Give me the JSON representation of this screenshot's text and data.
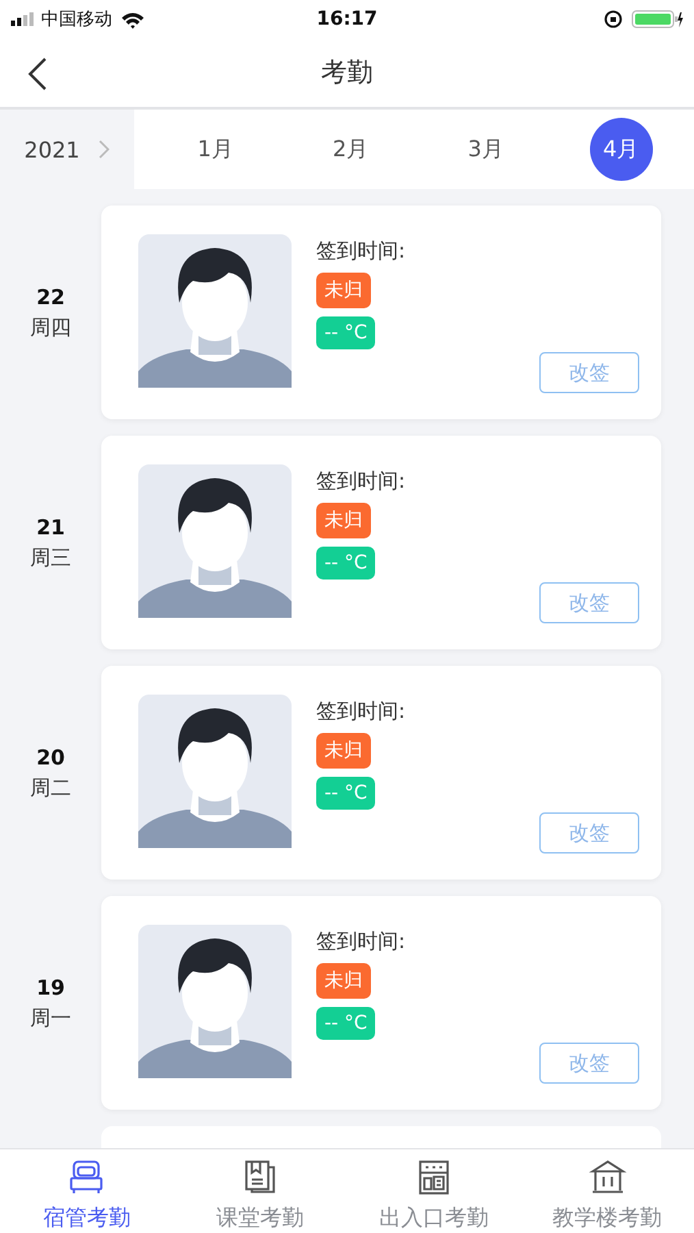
{
  "status_bar": {
    "carrier": "中国移动",
    "time": "16:17"
  },
  "nav": {
    "title": "考勤"
  },
  "month_bar": {
    "year": "2021",
    "months": [
      {
        "label": "1月",
        "selected": false
      },
      {
        "label": "2月",
        "selected": false
      },
      {
        "label": "3月",
        "selected": false
      },
      {
        "label": "4月",
        "selected": true
      }
    ]
  },
  "records": [
    {
      "day": "22",
      "weekday": "周四",
      "sign_label": "签到时间:",
      "status": "未归",
      "temperature": "-- °C",
      "action": "改签"
    },
    {
      "day": "21",
      "weekday": "周三",
      "sign_label": "签到时间:",
      "status": "未归",
      "temperature": "-- °C",
      "action": "改签"
    },
    {
      "day": "20",
      "weekday": "周二",
      "sign_label": "签到时间:",
      "status": "未归",
      "temperature": "-- °C",
      "action": "改签"
    },
    {
      "day": "19",
      "weekday": "周一",
      "sign_label": "签到时间:",
      "status": "未归",
      "temperature": "-- °C",
      "action": "改签"
    }
  ],
  "tab_bar": [
    {
      "label": "宿管考勤",
      "kind": "bed",
      "selected": true
    },
    {
      "label": "课堂考勤",
      "kind": "book",
      "selected": false
    },
    {
      "label": "出入口考勤",
      "kind": "gate",
      "selected": false
    },
    {
      "label": "教学楼考勤",
      "kind": "building",
      "selected": false
    }
  ]
}
